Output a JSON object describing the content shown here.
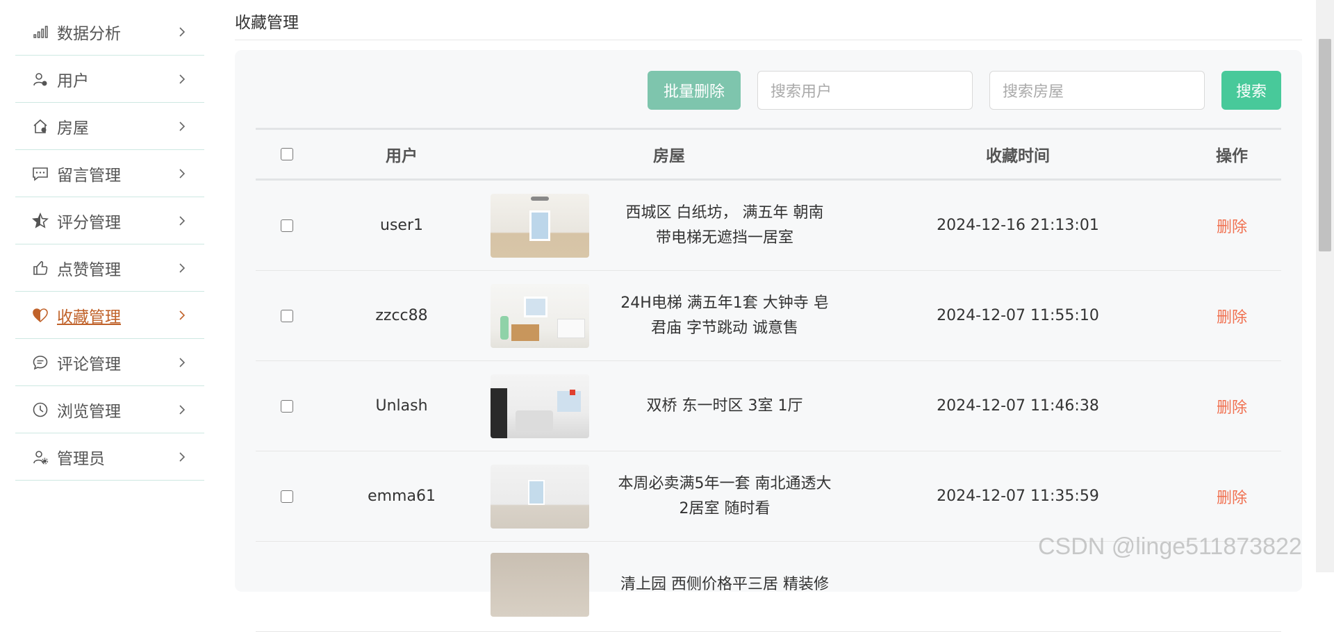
{
  "sidebar": {
    "items": [
      {
        "label": "数据分析",
        "icon": "bar-chart-icon"
      },
      {
        "label": "用户",
        "icon": "user-icon"
      },
      {
        "label": "房屋",
        "icon": "house-icon"
      },
      {
        "label": "留言管理",
        "icon": "message-icon"
      },
      {
        "label": "评分管理",
        "icon": "star-icon"
      },
      {
        "label": "点赞管理",
        "icon": "thumbs-up-icon"
      },
      {
        "label": "收藏管理",
        "icon": "heart-icon",
        "active": true
      },
      {
        "label": "评论管理",
        "icon": "comment-icon"
      },
      {
        "label": "浏览管理",
        "icon": "clock-icon"
      },
      {
        "label": "管理员",
        "icon": "admin-icon"
      }
    ]
  },
  "page": {
    "title": "收藏管理"
  },
  "toolbar": {
    "batch_delete": "批量删除",
    "search_user_placeholder": "搜索用户",
    "search_house_placeholder": "搜索房屋",
    "search_button": "搜索"
  },
  "table": {
    "headers": {
      "user": "用户",
      "house": "房屋",
      "time": "收藏时间",
      "op": "操作"
    },
    "rows": [
      {
        "user": "user1",
        "house_line1": "西城区 白纸坊， 满五年 朝南",
        "house_line2": "带电梯无遮挡一居室",
        "time": "2024-12-16 21:13:01",
        "op": "删除"
      },
      {
        "user": "zzcc88",
        "house_line1": "24H电梯 满五年1套 大钟寺 皂",
        "house_line2": "君庙 字节跳动 诚意售",
        "time": "2024-12-07 11:55:10",
        "op": "删除"
      },
      {
        "user": "Unlash",
        "house_line1": "双桥 东一时区 3室 1厅",
        "house_line2": "",
        "time": "2024-12-07 11:46:38",
        "op": "删除"
      },
      {
        "user": "emma61",
        "house_line1": "本周必卖满5年一套 南北通透大",
        "house_line2": "2居室 随时看",
        "time": "2024-12-07 11:35:59",
        "op": "删除"
      },
      {
        "user": "",
        "house_line1": "清上园 西侧价格平三居 精装修",
        "house_line2": "",
        "time": "",
        "op": ""
      }
    ]
  },
  "watermark": "CSDN @linge511873822",
  "colors": {
    "accent": "#48c99a",
    "active_nav": "#c0622a",
    "delete_text": "#f07050"
  }
}
